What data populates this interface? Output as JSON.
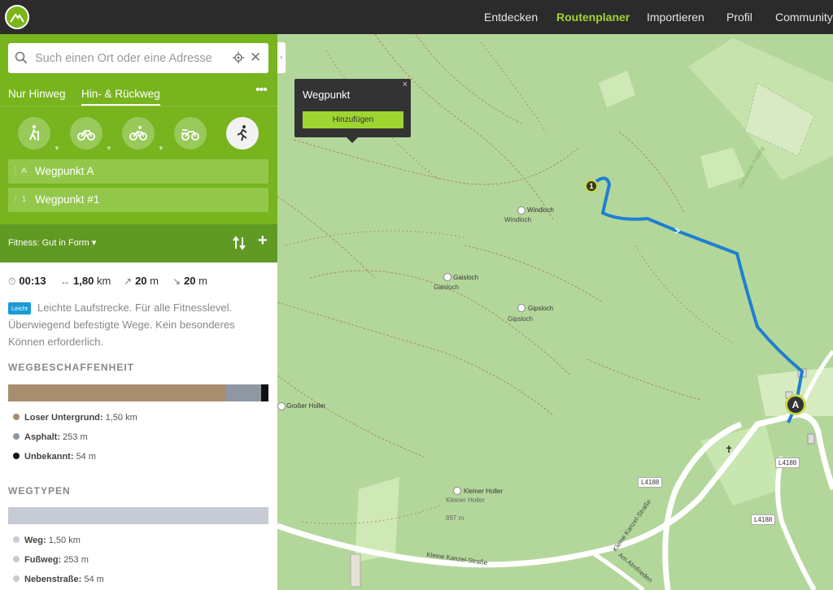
{
  "nav": {
    "items": [
      "Entdecken",
      "Routenplaner",
      "Importieren",
      "Profil",
      "Community"
    ],
    "active": "Routenplaner"
  },
  "search": {
    "placeholder": "Such einen Ort oder eine Adresse"
  },
  "route_tabs": {
    "oneway": "Nur Hinweg",
    "return": "Hin- & Rückweg"
  },
  "sports": [
    "wandern-icon",
    "rennrad-icon",
    "mountainbike-icon",
    "touring-bike-icon",
    "laufen-icon"
  ],
  "waypoints": [
    {
      "handle": "A",
      "label": "Wegpunkt A"
    },
    {
      "handle": "1",
      "label": "Wegpunkt #1"
    }
  ],
  "fitness": {
    "label": "Fitness: Gut in Form"
  },
  "stats": {
    "duration": "00:13",
    "distance": "1,80",
    "distance_unit": "km",
    "ascent": "20",
    "descent": "20",
    "unit_m": "m"
  },
  "difficulty": {
    "badge": "Leicht",
    "description": "Leichte Laufstrecke. Für alle Fitnesslevel. Überwiegend befestigte Wege. Kein besonderes Können erforderlich."
  },
  "surface": {
    "title": "WEGBESCHAFFENHEIT",
    "items": [
      {
        "label": "Loser Untergrund:",
        "value": "1,50 km",
        "color": "#a88e6e",
        "fraction": 0.833
      },
      {
        "label": "Asphalt:",
        "value": "253 m",
        "color": "#8f97a3",
        "fraction": 0.137
      },
      {
        "label": "Unbekannt:",
        "value": "54 m",
        "color": "#111111",
        "fraction": 0.03
      }
    ]
  },
  "waytypes": {
    "title": "WEGTYPEN",
    "items": [
      {
        "label": "Weg:",
        "value": "1,50 km",
        "color": "#c7ccd4",
        "fraction": 0.833
      },
      {
        "label": "Fußweg:",
        "value": "253 m",
        "color": "#c7ccd4",
        "fraction": 0.137
      },
      {
        "label": "Nebenstraße:",
        "value": "54 m",
        "color": "#c7ccd4",
        "fraction": 0.03
      }
    ]
  },
  "popup": {
    "title": "Wegpunkt",
    "button": "Hinzufügen",
    "close": "×"
  },
  "map": {
    "pois": [
      {
        "name": "Windloch",
        "sub": "Windloch"
      },
      {
        "name": "Gaisloch",
        "sub": "Gaisloch"
      },
      {
        "name": "Gipsloch",
        "sub": "Gipsloch"
      },
      {
        "name": "Großer Holler",
        "sub": ""
      },
      {
        "name": "Kleiner Holler",
        "sub": "Kleiner Holler"
      }
    ],
    "elevation": "897 m",
    "roads": [
      "L4188",
      "L4188",
      "L4188"
    ],
    "street_labels": [
      "Kleine Kanzel-Straße",
      "Kleine Kanzel-Straße",
      "Am Almfrieden"
    ],
    "area_label": "Gemeinde Puttling",
    "markers": {
      "start": "A",
      "waypoint": "1"
    },
    "colors": {
      "route": "#1f7fd1",
      "forest": "#b3d79a",
      "meadow": "#c8e6b0"
    }
  }
}
